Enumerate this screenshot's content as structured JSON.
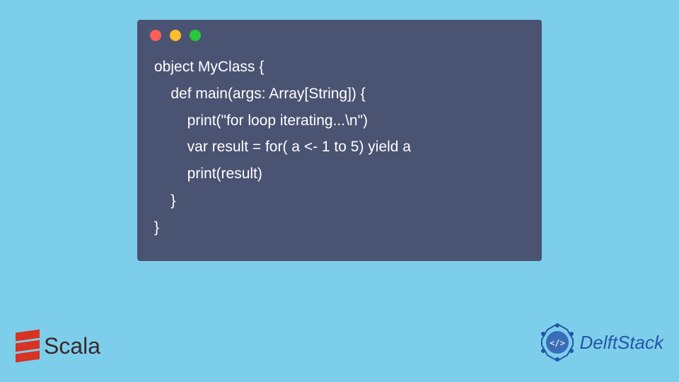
{
  "code": {
    "lines": [
      "object MyClass {",
      "    def main(args: Array[String]) {",
      "        print(\"for loop iterating...\\n\")",
      "        var result = for( a <- 1 to 5) yield a",
      "        print(result)",
      "    }",
      "}"
    ]
  },
  "logos": {
    "scala": "Scala",
    "delftstack": "DelftStack"
  },
  "colors": {
    "background": "#7dceeb",
    "codeBlock": "#4a5372",
    "scalaRed": "#d73222",
    "delftBlue": "#2456a6"
  }
}
